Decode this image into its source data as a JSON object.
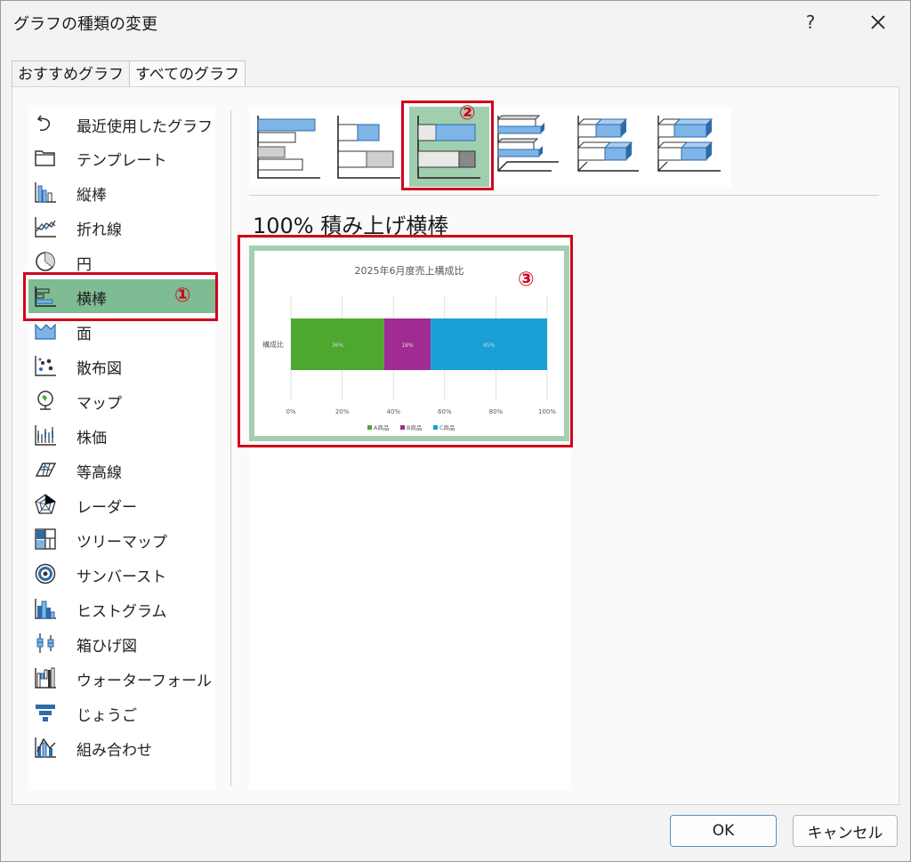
{
  "dialog": {
    "title": "グラフの種類の変更",
    "help": "?",
    "tabs": [
      "おすすめグラフ",
      "すべてのグラフ"
    ]
  },
  "sidebar": {
    "items": [
      {
        "label": "最近使用したグラフ",
        "icon": "undo-icon"
      },
      {
        "label": "テンプレート",
        "icon": "folder-icon"
      },
      {
        "label": "縦棒",
        "icon": "column-chart-icon"
      },
      {
        "label": "折れ線",
        "icon": "line-chart-icon"
      },
      {
        "label": "円",
        "icon": "pie-chart-icon"
      },
      {
        "label": "横棒",
        "icon": "bar-chart-icon",
        "selected": true
      },
      {
        "label": "面",
        "icon": "area-chart-icon"
      },
      {
        "label": "散布図",
        "icon": "scatter-chart-icon"
      },
      {
        "label": "マップ",
        "icon": "map-chart-icon"
      },
      {
        "label": "株価",
        "icon": "stock-chart-icon"
      },
      {
        "label": "等高線",
        "icon": "surface-chart-icon"
      },
      {
        "label": "レーダー",
        "icon": "radar-chart-icon"
      },
      {
        "label": "ツリーマップ",
        "icon": "treemap-chart-icon"
      },
      {
        "label": "サンバースト",
        "icon": "sunburst-chart-icon"
      },
      {
        "label": "ヒストグラム",
        "icon": "histogram-chart-icon"
      },
      {
        "label": "箱ひげ図",
        "icon": "box-whisker-chart-icon"
      },
      {
        "label": "ウォーターフォール",
        "icon": "waterfall-chart-icon"
      },
      {
        "label": "じょうご",
        "icon": "funnel-chart-icon"
      },
      {
        "label": "組み合わせ",
        "icon": "combo-chart-icon"
      }
    ]
  },
  "subtypes": {
    "selected_index": 2,
    "icons": [
      "clustered-bar-icon",
      "stacked-bar-icon",
      "100-stacked-bar-icon",
      "3d-clustered-bar-icon",
      "3d-stacked-bar-icon",
      "3d-100-stacked-bar-icon"
    ]
  },
  "chart_type_title": "100% 積み上げ横棒",
  "preview_chart": {
    "title": "2025年6月度売上構成比",
    "category": "構成比",
    "x_ticks": [
      "0%",
      "20%",
      "40%",
      "60%",
      "80%",
      "100%"
    ],
    "segments": [
      {
        "name": "A商品",
        "label": "36%",
        "color": "#4ea72e"
      },
      {
        "name": "B商品",
        "label": "18%",
        "color": "#a02b93"
      },
      {
        "name": "C商品",
        "label": "45%",
        "color": "#1a9fd6"
      }
    ]
  },
  "chart_data": {
    "type": "bar",
    "title": "2025年6月度売上構成比",
    "categories": [
      "構成比"
    ],
    "series": [
      {
        "name": "A商品",
        "values": [
          36
        ]
      },
      {
        "name": "B商品",
        "values": [
          18
        ]
      },
      {
        "name": "C商品",
        "values": [
          45
        ]
      }
    ],
    "xlim": [
      0,
      100
    ],
    "x_tick_labels": [
      "0%",
      "20%",
      "40%",
      "60%",
      "80%",
      "100%"
    ],
    "stacked": "100%",
    "grid": true,
    "legend_position": "bottom"
  },
  "annotations": [
    "①",
    "②",
    "③"
  ],
  "buttons": {
    "ok": "OK",
    "cancel": "キャンセル"
  },
  "colors": {
    "selection": "#7fbc94",
    "annotation": "#d0021b",
    "bar_blue": "#7fb4e6"
  }
}
